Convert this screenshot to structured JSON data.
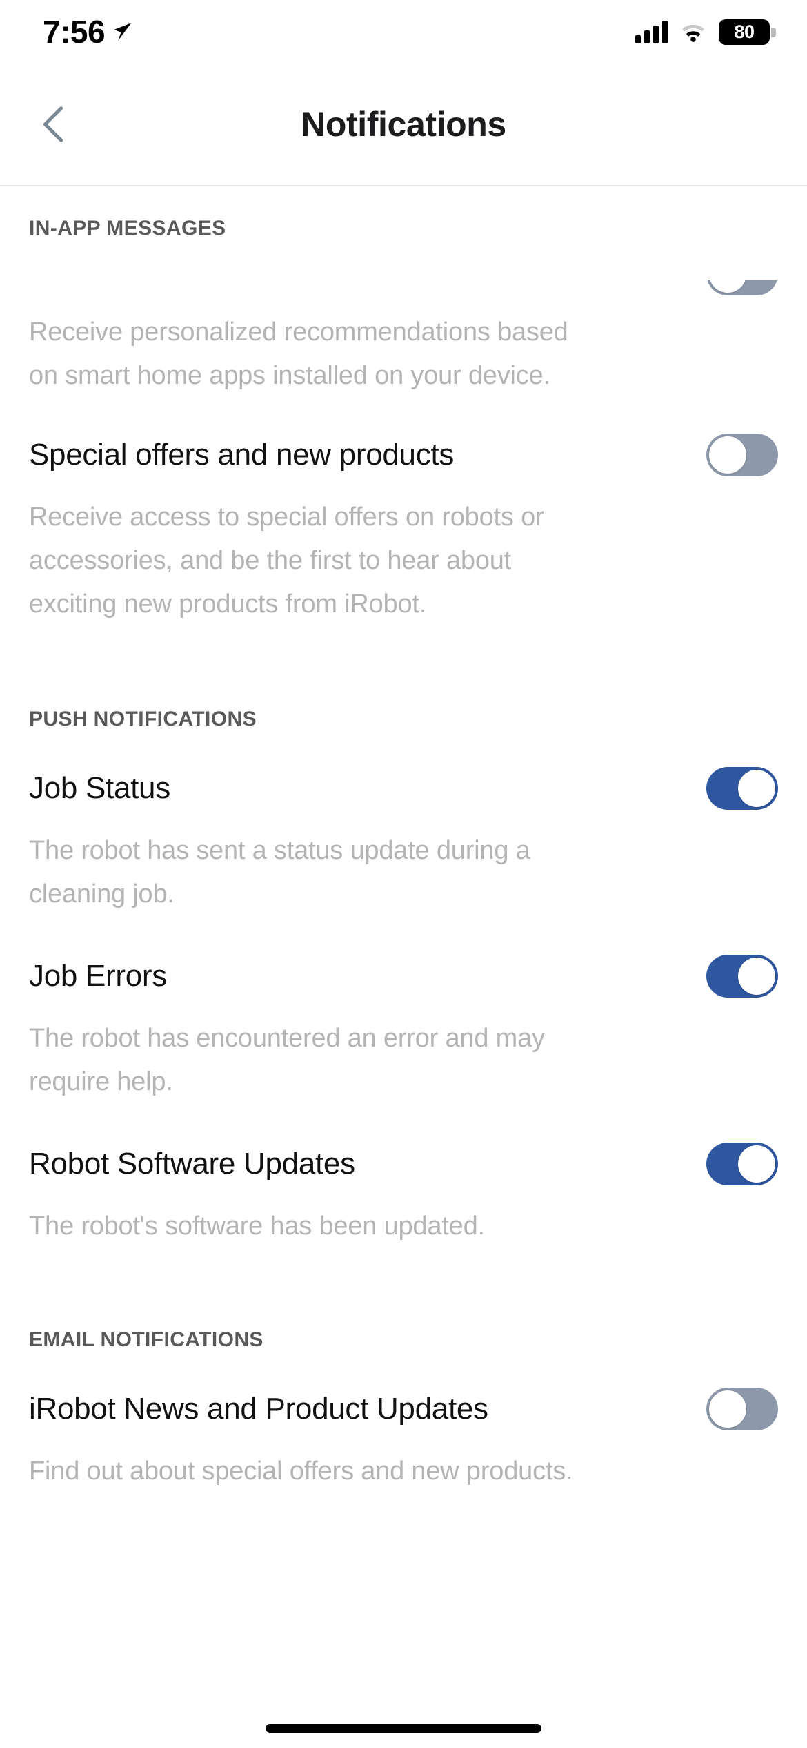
{
  "status_bar": {
    "time": "7:56",
    "location_icon": "location-arrow-icon",
    "cellular_icon": "cellular-bars-icon",
    "wifi_icon": "wifi-icon",
    "battery_level": "80"
  },
  "header": {
    "back_icon": "chevron-left-icon",
    "title": "Notifications"
  },
  "colors": {
    "toggle_on": "#2f57a0",
    "toggle_off": "#8d99ab",
    "title_text": "#1c1c1e",
    "description_text": "#b4b4b4",
    "section_header_text": "#595959",
    "back_chevron": "#7a8896"
  },
  "sections": [
    {
      "header": "IN-APP MESSAGES",
      "clipped_row": {
        "toggle_state": "off"
      },
      "rows": [
        {
          "title": "",
          "description_lines": [
            "Receive personalized recommendations based",
            "on smart home apps installed on your device."
          ],
          "toggle_state": "off",
          "title_hidden": true
        },
        {
          "title": "Special offers and new products",
          "description_lines": [
            "Receive access to special offers on robots or",
            "accessories, and be the first to hear about",
            "exciting new products from iRobot."
          ],
          "toggle_state": "off"
        }
      ]
    },
    {
      "header": "PUSH NOTIFICATIONS",
      "rows": [
        {
          "title": "Job Status",
          "description_lines": [
            "The robot has sent a status update during a",
            "cleaning job."
          ],
          "toggle_state": "on"
        },
        {
          "title": "Job Errors",
          "description_lines": [
            "The robot has encountered an error and may",
            "require help."
          ],
          "toggle_state": "on"
        },
        {
          "title": "Robot Software Updates",
          "description_lines": [
            "The robot's software has been updated."
          ],
          "toggle_state": "on"
        }
      ]
    },
    {
      "header": "EMAIL NOTIFICATIONS",
      "rows": [
        {
          "title": "iRobot News and Product Updates",
          "description_lines": [
            "Find out about special offers and new products."
          ],
          "toggle_state": "off"
        }
      ]
    }
  ]
}
